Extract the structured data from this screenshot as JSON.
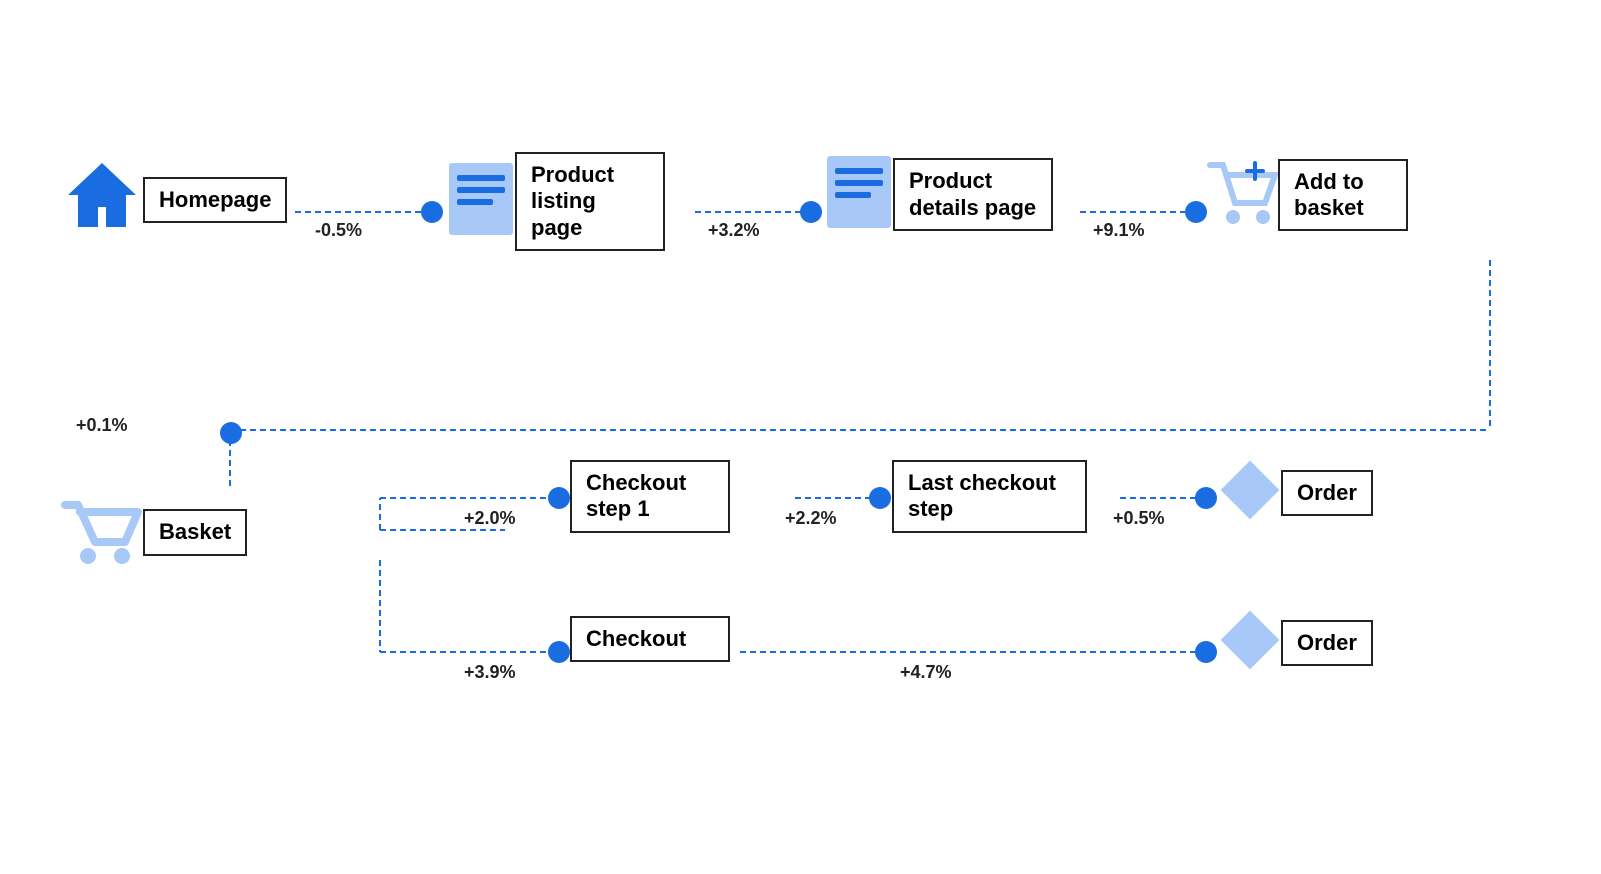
{
  "nodes": {
    "homepage": {
      "label": "Homepage"
    },
    "product_listing": {
      "label": "Product\nlisting page"
    },
    "product_details": {
      "label": "Product\ndetails page"
    },
    "add_to_basket": {
      "label": "Add to\nbasket"
    },
    "basket": {
      "label": "Basket"
    },
    "checkout_step1": {
      "label": "Checkout\nstep 1"
    },
    "last_checkout": {
      "label": "Last checkout\nstep"
    },
    "order1": {
      "label": "Order"
    },
    "checkout": {
      "label": "Checkout"
    },
    "order2": {
      "label": "Order"
    }
  },
  "connectors": {
    "homepage_to_listing": {
      "label": "-0.5%"
    },
    "listing_to_details": {
      "label": "+3.2%"
    },
    "details_to_basket_add": {
      "label": "+9.1%"
    },
    "add_to_basket_down": {
      "label": "+0.1%"
    },
    "basket_to_checkout1": {
      "label": "+2.0%"
    },
    "checkout1_to_last": {
      "label": "+2.2%"
    },
    "last_to_order1": {
      "label": "+0.5%"
    },
    "basket_to_checkout": {
      "label": "+3.9%"
    },
    "checkout_to_order2": {
      "label": "+4.7%"
    }
  },
  "colors": {
    "blue": "#1a6de0",
    "light_blue": "#a8c8f8",
    "blue_icon": "#4a90d9"
  }
}
